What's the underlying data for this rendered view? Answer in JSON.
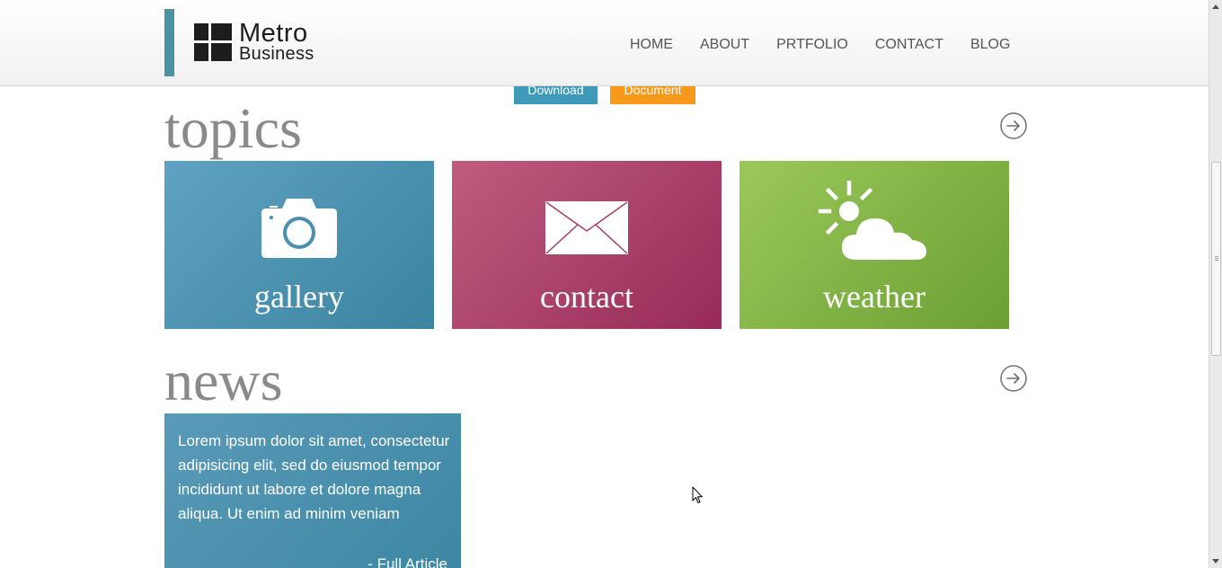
{
  "logo": {
    "line1": "Metro",
    "line2": "Business"
  },
  "nav": [
    {
      "label": "HOME"
    },
    {
      "label": "ABOUT"
    },
    {
      "label": "PRTFOLIO"
    },
    {
      "label": "CONTACT"
    },
    {
      "label": "BLOG"
    }
  ],
  "buttons": {
    "download": "Download",
    "document": "Document"
  },
  "topics": {
    "title": "topics",
    "tiles": [
      {
        "label": "gallery",
        "icon": "camera-icon",
        "color": "#4a93b3"
      },
      {
        "label": "contact",
        "icon": "envelope-icon",
        "color": "#ad4369"
      },
      {
        "label": "weather",
        "icon": "sun-cloud-icon",
        "color": "#84b547"
      }
    ]
  },
  "news": {
    "title": "news",
    "card": {
      "text": "Lorem ipsum dolor sit amet, consectetur adipisicing elit, sed do eiusmod tempor incididunt ut labore et dolore magna aliqua. Ut enim ad minim veniam",
      "link": "- Full Article"
    }
  },
  "colors": {
    "accent": "#4a92a4",
    "download": "#3f9ab9",
    "document": "#f79a1c"
  }
}
